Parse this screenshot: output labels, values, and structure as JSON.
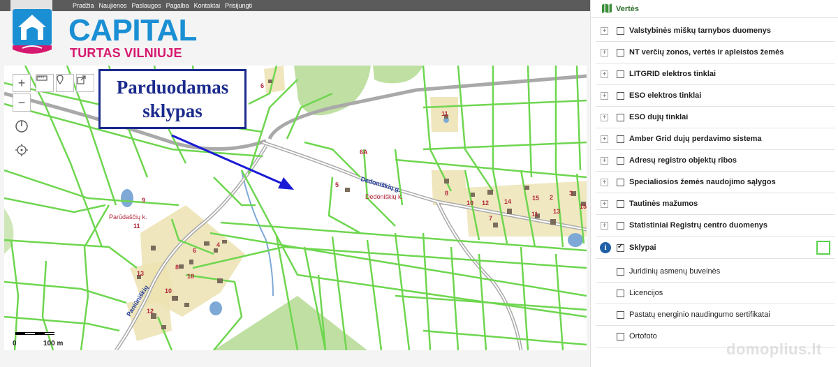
{
  "nav": {
    "items": [
      "Pradžia",
      "Naujienos",
      "Paslaugos",
      "Pagalba",
      "Kontaktai",
      "Prisijungti"
    ]
  },
  "logo": {
    "main": "CAPITAL",
    "sub": "TURTAS VILNIUJE"
  },
  "map": {
    "callout": [
      "Parduodamas",
      "sklypas"
    ],
    "street_labels": [
      "Dedoniškių g.",
      "Dedoniškių k.",
      "Parūdaščių k.",
      "Paniūniškių"
    ],
    "parcel_labels": [
      "6",
      "11",
      "6A",
      "5",
      "8",
      "10",
      "12",
      "14",
      "15",
      "2",
      "3",
      "13",
      "15",
      "7",
      "11",
      "9",
      "11",
      "6",
      "4",
      "8",
      "13",
      "10",
      "12",
      "18"
    ],
    "scale": {
      "start": "0",
      "end": "100 m"
    },
    "controls": [
      "zoom-in",
      "zoom-out",
      "measure",
      "marker",
      "share",
      "compass",
      "locate"
    ]
  },
  "panel": {
    "title": "Vertės",
    "layers": [
      {
        "label": "Valstybinės miškų tarnybos duomenys",
        "expandable": true,
        "checked": false
      },
      {
        "label": "NT verčių zonos, vertės ir apleistos žemės",
        "expandable": true,
        "checked": false
      },
      {
        "label": "LITGRID elektros tinklai",
        "expandable": true,
        "checked": false
      },
      {
        "label": "ESO elektros tinklai",
        "expandable": true,
        "checked": false
      },
      {
        "label": "ESO dujų tinklai",
        "expandable": true,
        "checked": false
      },
      {
        "label": "Amber Grid dujų perdavimo sistema",
        "expandable": true,
        "checked": false
      },
      {
        "label": "Adresų registro objektų ribos",
        "expandable": true,
        "checked": false
      },
      {
        "label": "Specialiosios žemės naudojimo sąlygos",
        "expandable": true,
        "checked": false
      },
      {
        "label": "Tautinės mažumos",
        "expandable": true,
        "checked": false
      },
      {
        "label": "Statistiniai Registrų centro duomenys",
        "expandable": true,
        "checked": false
      },
      {
        "label": "Sklypai",
        "info": true,
        "checked": true
      },
      {
        "label": "Juridinių asmenų buveinės",
        "checked": false
      },
      {
        "label": "Licencijos",
        "checked": false
      },
      {
        "label": "Pastatų energinio naudingumo sertifikatai",
        "checked": false
      },
      {
        "label": "Ortofoto",
        "checked": false
      }
    ]
  },
  "watermark": "domoplius.lt",
  "colors": {
    "parcel_border": "#6ed64f",
    "road": "#a9a9a9",
    "forest": "#bfe0a2",
    "building_area": "#ece2b2",
    "callout": "#1a2a8c",
    "logo_blue": "#1b8fd4",
    "logo_pink": "#d6196f"
  }
}
